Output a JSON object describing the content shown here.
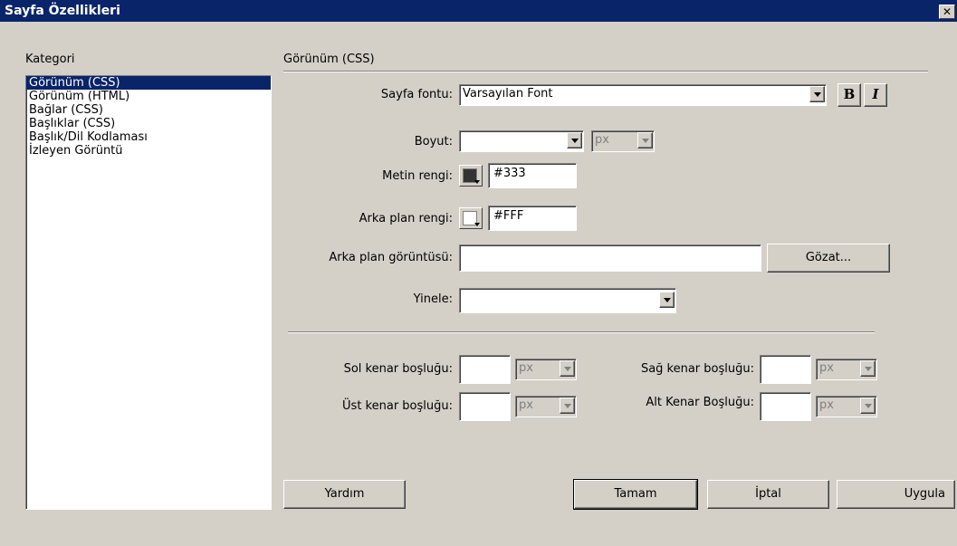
{
  "window": {
    "title": "Sayfa Özellikleri",
    "close_glyph": "✕"
  },
  "category": {
    "heading": "Kategori",
    "items": [
      {
        "label": "Görünüm (CSS)",
        "selected": true
      },
      {
        "label": "Görünüm (HTML)",
        "selected": false
      },
      {
        "label": "Bağlar (CSS)",
        "selected": false
      },
      {
        "label": "Başlıklar (CSS)",
        "selected": false
      },
      {
        "label": "Başlık/Dil Kodlaması",
        "selected": false
      },
      {
        "label": "İzleyen Görüntü",
        "selected": false
      }
    ]
  },
  "panel": {
    "heading": "Görünüm (CSS)"
  },
  "fields": {
    "font_label": "Sayfa fontu:",
    "font_value": "Varsayılan Font",
    "bold": "B",
    "italic": "I",
    "size_label": "Boyut:",
    "size_value": "",
    "size_unit": "px",
    "text_color_label": "Metin rengi:",
    "text_color_value": "#333",
    "bg_color_label": "Arka plan rengi:",
    "bg_color_value": "#FFF",
    "bg_image_label": "Arka plan görüntüsü:",
    "bg_image_value": "",
    "browse": "Gözat...",
    "repeat_label": "Yinele:",
    "repeat_value": ""
  },
  "margins": {
    "left_label": "Sol kenar boşluğu:",
    "right_label": "Sağ kenar boşluğu:",
    "top_label": "Üst kenar boşluğu:",
    "bottom_label": "Alt Kenar Boşluğu:",
    "unit": "px"
  },
  "buttons": {
    "help": "Yardım",
    "ok": "Tamam",
    "cancel": "İptal",
    "apply": "Uygula"
  },
  "colors": {
    "title_bar": "#0a246a",
    "dialog_bg": "#d4d0c8",
    "selection": "#0a246a",
    "text_swatch": "#333333",
    "bg_swatch": "#ffffff"
  }
}
